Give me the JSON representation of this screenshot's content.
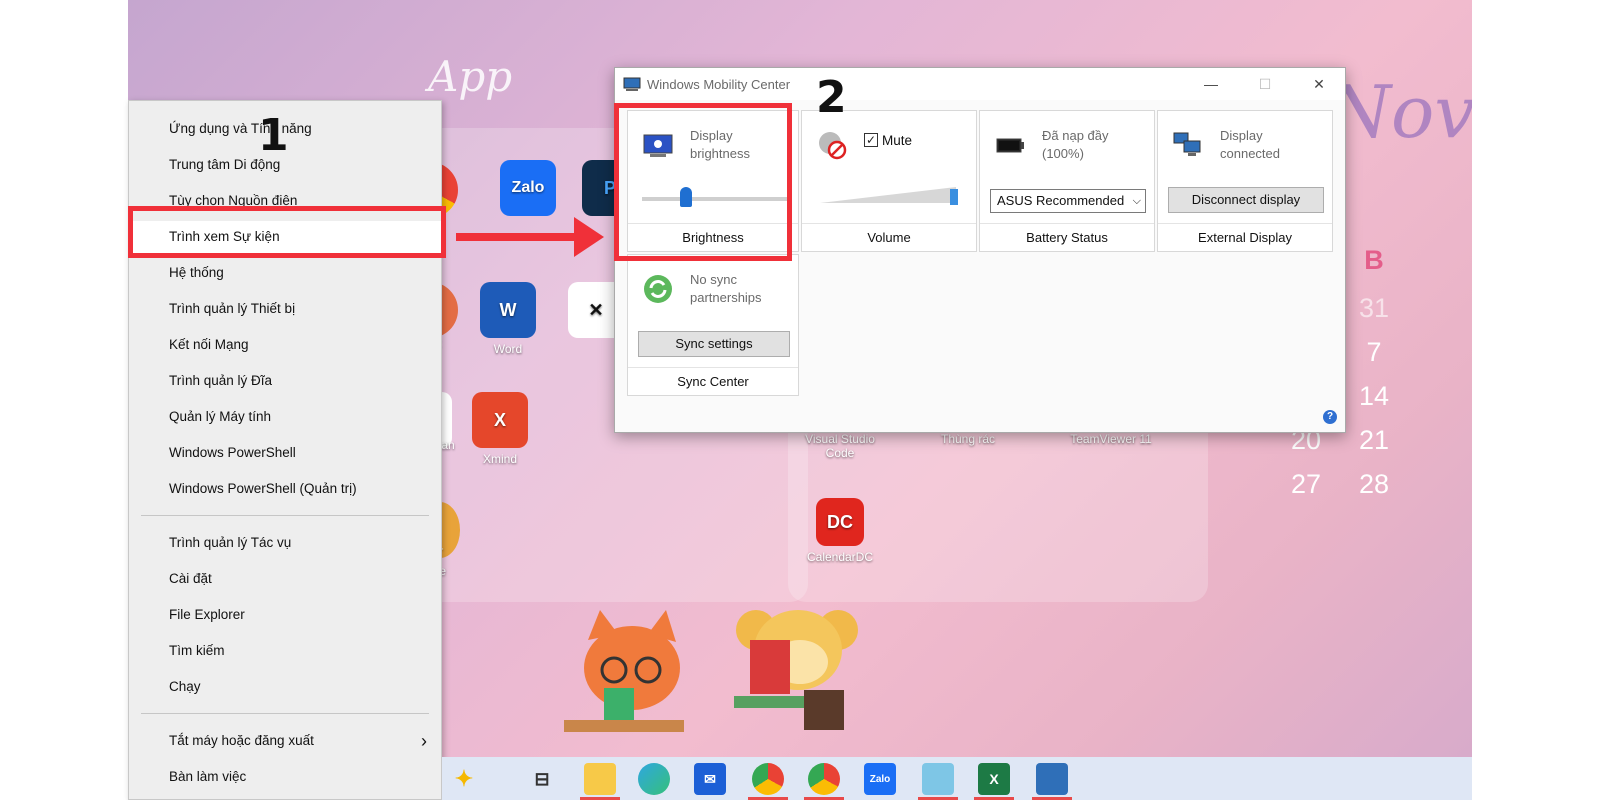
{
  "desktop": {
    "script_labels": [
      "App",
      "Nov"
    ],
    "icons": [
      {
        "name": "zalo",
        "label": "Zalo",
        "tile_text": "Zalo",
        "color": "#1a6ef5"
      },
      {
        "name": "word",
        "label": "Word",
        "tile_text": "W",
        "color": "#1e5bb8"
      },
      {
        "name": "xmind",
        "label": "Xmind",
        "tile_text": "X",
        "color": "#e5472b"
      },
      {
        "name": "vscode",
        "label": "Visual Studio Code",
        "tile_text": "",
        "color": ""
      },
      {
        "name": "trash",
        "label": "Thùng rác",
        "tile_text": "",
        "color": ""
      },
      {
        "name": "teamviewer",
        "label": "TeamViewer 11",
        "tile_text": "",
        "color": ""
      },
      {
        "name": "calendardc",
        "label": "CalendarDC",
        "tile_text": "DC",
        "color": "#e0261e"
      }
    ],
    "partial_labels": [
      "y",
      "oint",
      "lean",
      "T",
      "te"
    ],
    "calendar": {
      "header": "B",
      "rows": [
        [
          "31"
        ],
        [
          "7"
        ],
        [
          "14"
        ],
        [
          "20",
          "21"
        ],
        [
          "27",
          "28"
        ]
      ]
    }
  },
  "context_menu": {
    "items": [
      {
        "label": "Ứng dụng và Tính năng",
        "group": 1
      },
      {
        "label": "Trung tâm Di động",
        "group": 1
      },
      {
        "label": "Tùy chọn Nguồn điện",
        "group": 1
      },
      {
        "label": "Trình xem Sự kiện",
        "group": 1,
        "highlighted": true
      },
      {
        "label": "Hệ thống",
        "group": 1
      },
      {
        "label": "Trình quản lý Thiết bị",
        "group": 1
      },
      {
        "label": "Kết nối Mạng",
        "group": 1
      },
      {
        "label": "Trình quản lý Đĩa",
        "group": 1
      },
      {
        "label": "Quản lý Máy tính",
        "group": 1
      },
      {
        "label": "Windows PowerShell",
        "group": 1
      },
      {
        "label": "Windows PowerShell (Quản trị)",
        "group": 1
      },
      {
        "label": "Trình quản lý Tác vụ",
        "group": 2
      },
      {
        "label": "Cài đặt",
        "group": 2
      },
      {
        "label": "File Explorer",
        "group": 2
      },
      {
        "label": "Tìm kiếm",
        "group": 2
      },
      {
        "label": "Chạy",
        "group": 2
      },
      {
        "label": "Tắt máy hoặc đăng xuất",
        "group": 3,
        "submenu": true
      },
      {
        "label": "Bàn làm việc",
        "group": 3
      }
    ],
    "submenu_arrow": "›"
  },
  "annotations": {
    "step1": "1",
    "step2": "2",
    "highlight_color": "#f03039"
  },
  "mobility_center": {
    "title": "Windows Mobility Center",
    "controls": {
      "minimize": "—",
      "maximize": "☐",
      "close": "✕"
    },
    "brightness": {
      "text": "Display brightness",
      "caption": "Brightness",
      "level": 0.3
    },
    "volume": {
      "mute_label": "Mute",
      "muted": true,
      "caption": "Volume"
    },
    "battery": {
      "text_line1": "Đã nạp đầy",
      "text_line2": "(100%)",
      "plan": "ASUS Recommended",
      "caption": "Battery Status"
    },
    "display": {
      "text_line1": "Display",
      "text_line2": "connected",
      "button": "Disconnect display",
      "caption": "External Display"
    },
    "sync": {
      "text_line1": "No sync",
      "text_line2": "partnerships",
      "button": "Sync settings",
      "caption": "Sync Center"
    },
    "help_icon": "?"
  },
  "taskbar": {
    "icons": [
      "sparkle-icon",
      "task-view-icon",
      "file-explorer-icon",
      "edge-icon",
      "mail-icon",
      "chrome-icon",
      "chrome-profile-icon",
      "zalo-icon",
      "notes-icon",
      "excel-icon",
      "mobility-center-icon"
    ]
  }
}
